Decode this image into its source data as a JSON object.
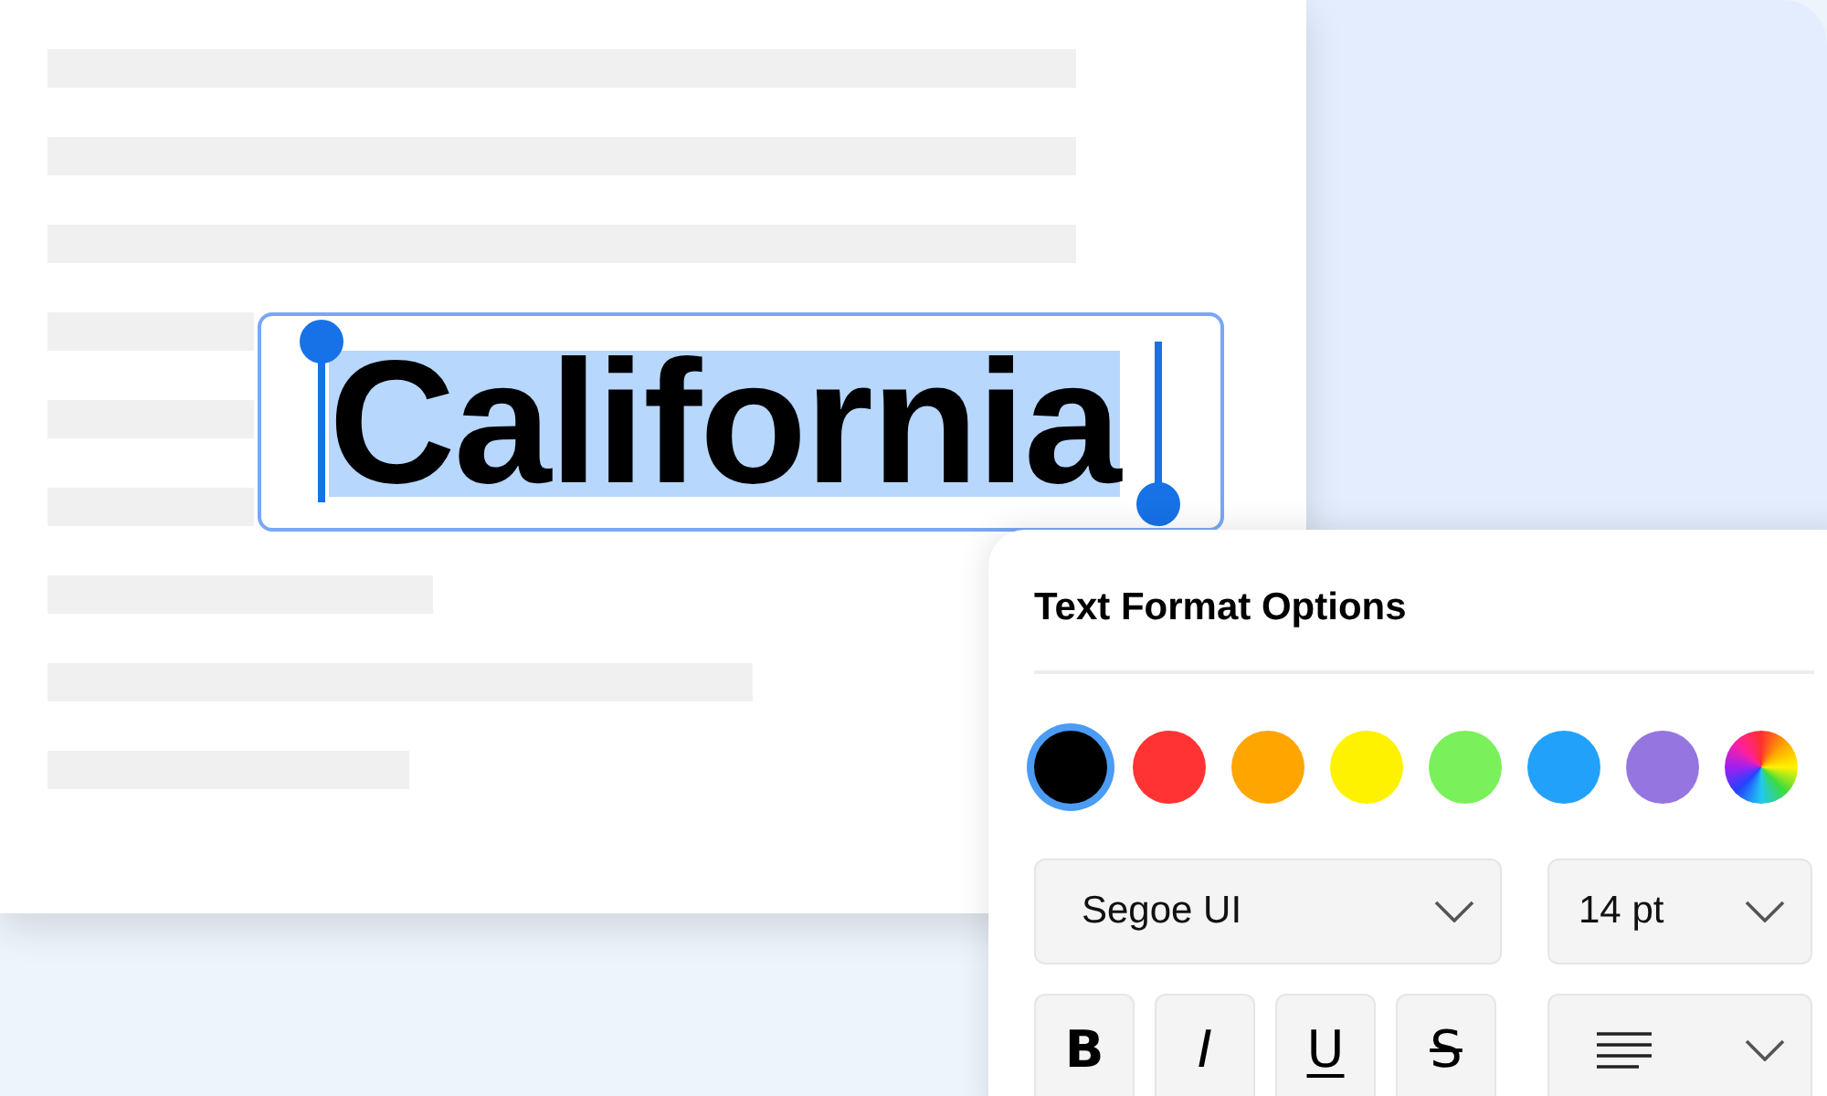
{
  "document": {
    "selected_text": "California"
  },
  "format_panel": {
    "title": "Text Format Options",
    "colors": [
      {
        "kind": "solid",
        "color": "#000000",
        "selected": true
      },
      {
        "kind": "solid",
        "color": "#ff3333",
        "selected": false
      },
      {
        "kind": "solid",
        "color": "#ffa500",
        "selected": false
      },
      {
        "kind": "solid",
        "color": "#fff200",
        "selected": false
      },
      {
        "kind": "solid",
        "color": "#7af05a",
        "selected": false
      },
      {
        "kind": "solid",
        "color": "#22a1fb",
        "selected": false
      },
      {
        "kind": "solid",
        "color": "#9575e0",
        "selected": false
      },
      {
        "kind": "spectrum",
        "selected": false
      }
    ],
    "font_family": "Segoe UI",
    "font_size": "14 pt",
    "style_buttons": [
      {
        "kind": "bold",
        "label": "B"
      },
      {
        "kind": "italic",
        "label": "I"
      },
      {
        "kind": "underline",
        "label": "U"
      },
      {
        "kind": "strikethrough",
        "label": "S"
      }
    ]
  }
}
